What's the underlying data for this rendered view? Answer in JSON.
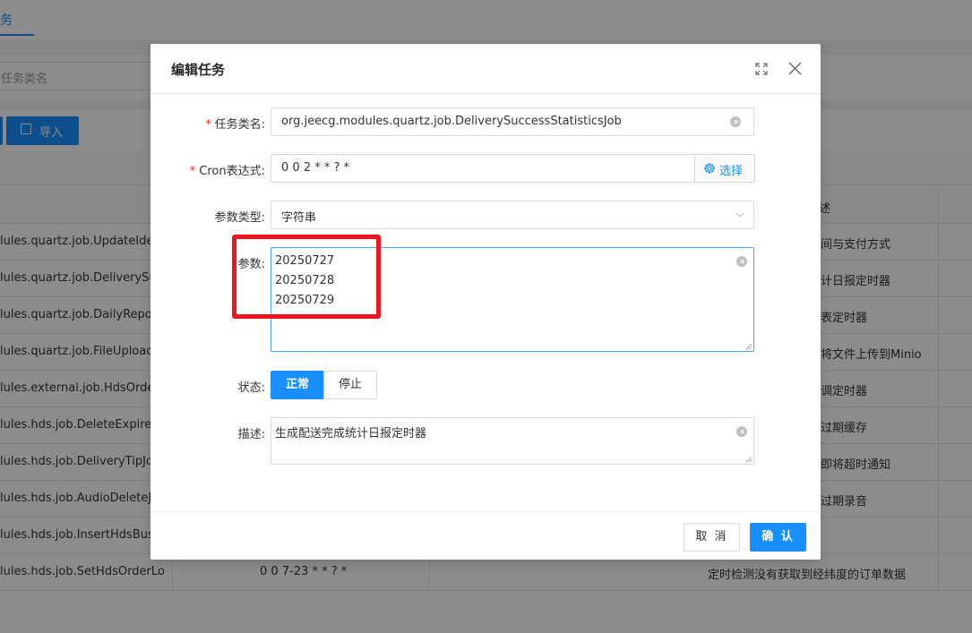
{
  "background": {
    "tab_label": "务",
    "search_placeholder": "任务类名",
    "import_button": "导入",
    "table_header_right": "述",
    "rows": [
      {
        "class_name": "lules.quartz.job.UpdateIdentity",
        "cron": "",
        "desc": "间与支付方式"
      },
      {
        "class_name": "lules.quartz.job.DeliverySuccessStatisticsJob",
        "cron": "",
        "desc": "计日报定时器"
      },
      {
        "class_name": "lules.quartz.job.DailyReportJob",
        "cron": "",
        "desc": "表定时器"
      },
      {
        "class_name": "lules.quartz.job.FileUploadJob",
        "cron": "",
        "desc": "将文件上传到Minio"
      },
      {
        "class_name": "lules.external.job.HdsOrderJob",
        "cron": "",
        "desc": "调定时器"
      },
      {
        "class_name": "lules.hds.job.DeleteExpireCacheJob",
        "cron": "",
        "desc": "过期缓存"
      },
      {
        "class_name": "lules.hds.job.DeliveryTipJob",
        "cron": "",
        "desc": "即将超时通知"
      },
      {
        "class_name": "lules.hds.job.AudioDeleteJob",
        "cron": "",
        "desc": "过期录音"
      },
      {
        "class_name": "lules.hds.job.InsertHdsBusinessJob",
        "cron": "",
        "desc": ""
      },
      {
        "class_name": "lules.hds.job.SetHdsOrderLo...",
        "cron": "0 0 7-23 * * ? *",
        "desc": "定时检测没有获取到经纬度的订单数据"
      }
    ]
  },
  "modal": {
    "title": "编辑任务",
    "fields": {
      "class_name_label": "任务类名:",
      "class_name_value": "org.jeecg.modules.quartz.job.DeliverySuccessStatisticsJob",
      "cron_label": "Cron表达式:",
      "cron_value": "0 0 2 * * ? *",
      "cron_select_button": "选择",
      "param_type_label": "参数类型:",
      "param_type_value": "字符串",
      "params_label": "参数:",
      "params_lines": [
        "20250727",
        "20250728",
        "20250729"
      ],
      "status_label": "状态:",
      "status_options": [
        "正常",
        "停止"
      ],
      "status_selected": "正常",
      "desc_label": "描述:",
      "desc_value": "生成配送完成统计日报定时器"
    },
    "footer": {
      "cancel": "取 消",
      "ok": "确 认"
    }
  },
  "colors": {
    "primary": "#1890ff",
    "required": "#f5222d",
    "highlight": "#f0141e"
  }
}
